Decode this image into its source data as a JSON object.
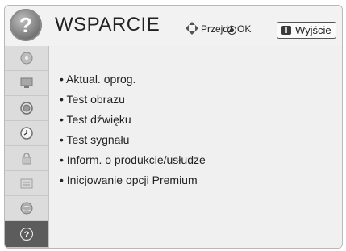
{
  "header": {
    "title": "WSPARCIE",
    "icon": "question-mark-icon",
    "nav_hint": "Przejdź",
    "ok_hint": "OK",
    "exit_label": "Wyjście"
  },
  "sidebar": {
    "items": [
      {
        "icon": "disc-icon"
      },
      {
        "icon": "monitor-icon"
      },
      {
        "icon": "speaker-icon"
      },
      {
        "icon": "clock-icon"
      },
      {
        "icon": "lock-icon"
      },
      {
        "icon": "settings-box-icon"
      },
      {
        "icon": "globe-icon"
      },
      {
        "icon": "question-mark-icon",
        "active": true
      }
    ]
  },
  "menu": {
    "items": [
      "• Aktual. oprog.",
      "• Test obrazu",
      "• Test dźwięku",
      "• Test sygnału",
      "• Inform. o produkcie/usłudze",
      "• Inicjowanie opcji Premium"
    ]
  },
  "colors": {
    "accent": "#5c5c5c",
    "background": "#f0f0f0",
    "sidebar": "#dcdcdc"
  }
}
